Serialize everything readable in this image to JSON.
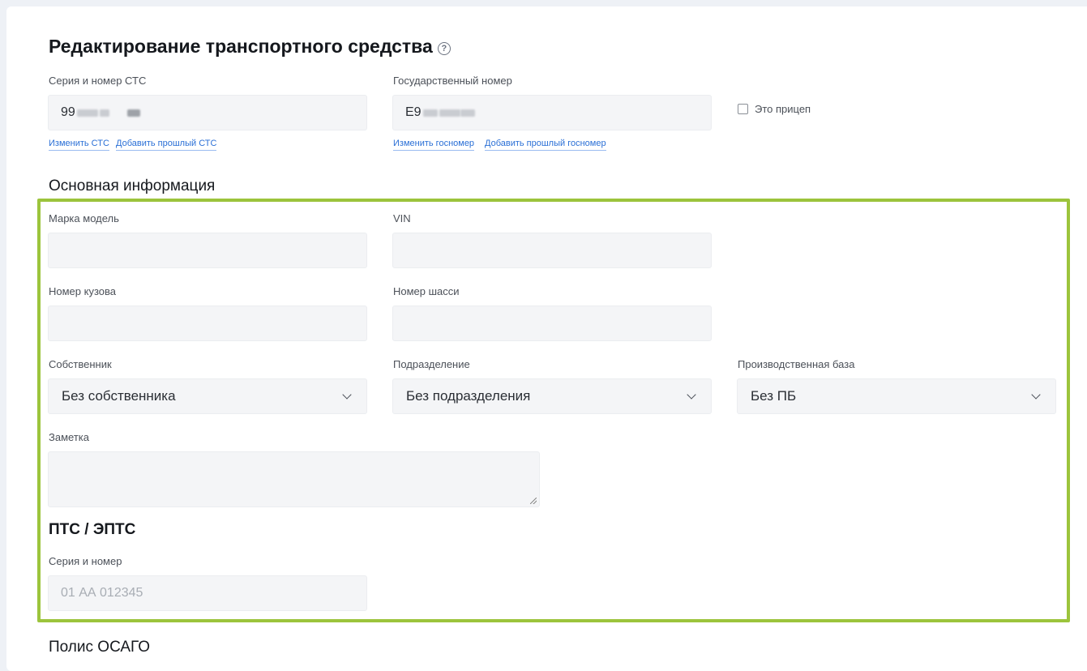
{
  "header": {
    "title": "Редактирование транспортного средства",
    "help_icon": "help-circle-icon"
  },
  "sts": {
    "label": "Серия и номер СТС",
    "value": "99",
    "change_link": "Изменить СТС",
    "add_previous_link": "Добавить прошлый СТС"
  },
  "plate": {
    "label": "Государственный номер",
    "value": "Е9",
    "change_link": "Изменить госномер",
    "add_previous_link": "Добавить прошлый госномер"
  },
  "trailer": {
    "label": "Это прицеп",
    "checked": false
  },
  "main_info": {
    "title": "Основная информация",
    "brand_model": {
      "label": "Марка модель",
      "value": ""
    },
    "vin": {
      "label": "VIN",
      "value": ""
    },
    "body_number": {
      "label": "Номер кузова",
      "value": ""
    },
    "chassis_number": {
      "label": "Номер шасси",
      "value": ""
    },
    "owner": {
      "label": "Собственник",
      "selected": "Без собственника"
    },
    "division": {
      "label": "Подразделение",
      "selected": "Без подразделения"
    },
    "production_base": {
      "label": "Производственная база",
      "selected": "Без ПБ"
    },
    "note": {
      "label": "Заметка",
      "value": ""
    }
  },
  "pts": {
    "title": "ПТС / ЭПТС",
    "series_number": {
      "label": "Серия и номер",
      "placeholder": "01 АА 012345"
    }
  },
  "osago": {
    "title": "Полис ОСАГО"
  },
  "colors": {
    "highlight": "#9cc43c",
    "link": "#2a6fd6",
    "input_bg": "#f4f5f7"
  }
}
